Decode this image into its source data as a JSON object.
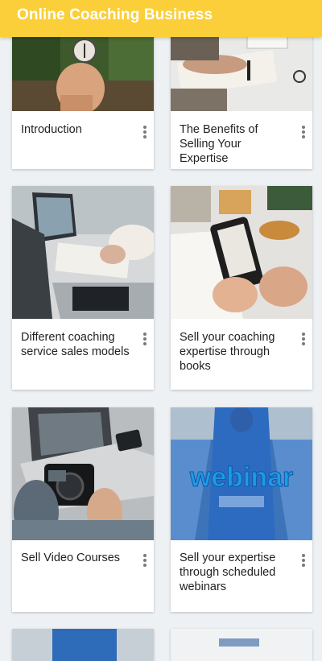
{
  "app_bar": {
    "title": "Online Coaching Business"
  },
  "courses": [
    {
      "title": "Introduction",
      "image": "hand-holding-compass-in-forest",
      "menu_icon": "more-vert-icon"
    },
    {
      "title": "The Benefits of Selling Your Expertise",
      "image": "writing-notes-at-desk",
      "menu_icon": "more-vert-icon"
    },
    {
      "title": "Different coaching service sales models",
      "image": "laptops-and-paperwork-on-desk",
      "menu_icon": "more-vert-icon"
    },
    {
      "title": "Sell your coaching expertise through books",
      "image": "hands-holding-ebook-reader",
      "menu_icon": "more-vert-icon"
    },
    {
      "title": "Sell Video Courses",
      "image": "camera-and-laptop",
      "menu_icon": "more-vert-icon"
    },
    {
      "title": "Sell your expertise through scheduled webinars",
      "image": "webinar-auditorium",
      "menu_icon": "more-vert-icon"
    },
    {
      "title": "",
      "image": "partial-card-blue",
      "menu_icon": "more-vert-icon"
    },
    {
      "title": "",
      "image": "partial-card-light",
      "menu_icon": "more-vert-icon"
    }
  ],
  "images": {
    "webinar_text": "webinar"
  },
  "colors": {
    "app_bar": "#fbcf3a",
    "background": "#eef1f4",
    "card": "#ffffff"
  }
}
